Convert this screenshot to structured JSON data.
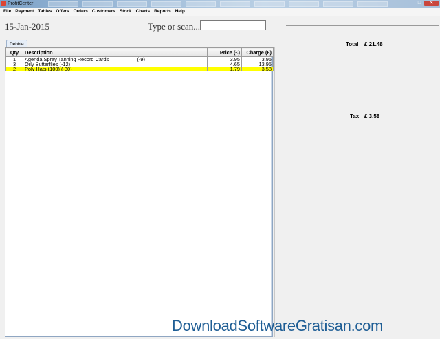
{
  "window": {
    "title": "ProfitCenter",
    "min_symbol": "‒",
    "max_symbol": "□",
    "close_symbol": "✕"
  },
  "menu": [
    "File",
    "Payment",
    "Tables",
    "Offers",
    "Orders",
    "Customers",
    "Stock",
    "Charts",
    "Reports",
    "Help"
  ],
  "header": {
    "date": "15-Jan-2015",
    "scan_label": "Type or scan...",
    "scan_value": ""
  },
  "tabs": [
    {
      "label": "Debbie",
      "active": true
    }
  ],
  "table": {
    "columns": [
      "Qty",
      "Description",
      "Price (£)",
      "Charge (£)"
    ],
    "rows": [
      {
        "qty": "1",
        "description": "Agenda Spray Tanning Record Cards",
        "discount": "(-9)",
        "price": "3.95",
        "charge": "3.95",
        "selected": false
      },
      {
        "qty": "3",
        "description": "Orly Butterflies (-12)",
        "discount": "",
        "price": "4.65",
        "charge": "13.95",
        "selected": false
      },
      {
        "qty": "2",
        "description": "Poly Hats (100) (-30)",
        "discount": "",
        "price": "1.79",
        "charge": "3.58",
        "selected": true
      }
    ]
  },
  "totals": {
    "total_label": "Total",
    "total_value": "£ 21.48",
    "tax_label": "Tax",
    "tax_value": "£ 3.58"
  },
  "watermark": "DownloadSoftwareGratisan.com",
  "colors": {
    "selected_row": "#ffff00",
    "titlebar": "#9fbcd9",
    "close_button": "#c9463d",
    "watermark": "#1f5e95"
  }
}
